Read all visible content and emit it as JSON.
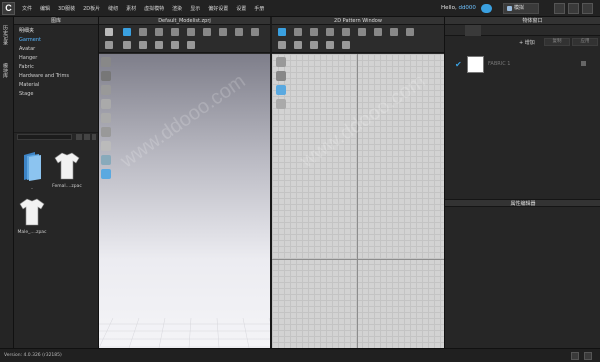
{
  "app": {
    "logo_letter": "C",
    "menus": [
      "文件",
      "编辑",
      "3D服装",
      "2D板片",
      "缝纫",
      "素材",
      "虚拟模特",
      "渲染",
      "显示",
      "偏好设置",
      "设置",
      "手册"
    ],
    "greeting": "Hello,",
    "username": "dd000",
    "simulate_label": "模拟"
  },
  "left_strip": {
    "tabs": [
      "历史记录",
      "模块库"
    ]
  },
  "library": {
    "title": "图库",
    "tree_root": "明细夹",
    "tree_items": [
      "Garment",
      "Avatar",
      "Hanger",
      "Fabric",
      "Hardware and Trims",
      "Material",
      "Stage"
    ],
    "selected_item": "Garment",
    "thumbnails": [
      {
        "label": "..",
        "icon": "folder-icon"
      },
      {
        "label": "Femal....zpac",
        "icon": "tshirt-icon"
      },
      {
        "label": "Male_....zpac",
        "icon": "tshirt-icon"
      }
    ]
  },
  "view3d": {
    "title": "Default_Modelist.zprj"
  },
  "view2d": {
    "title": "2D Pattern Window"
  },
  "object_browser": {
    "title": "物体窗口",
    "add_label": "+ 增加",
    "copy_label": "复制",
    "apply_label": "应用",
    "fabric_name": "FABRIC 1"
  },
  "property_editor": {
    "title": "属性编辑器"
  },
  "status": {
    "version": "Version: 4.0.326 (r32185)"
  },
  "colors": {
    "accent": "#3aa0e0",
    "selected": "#57b6ff"
  },
  "watermark": "www.ddooo.com"
}
